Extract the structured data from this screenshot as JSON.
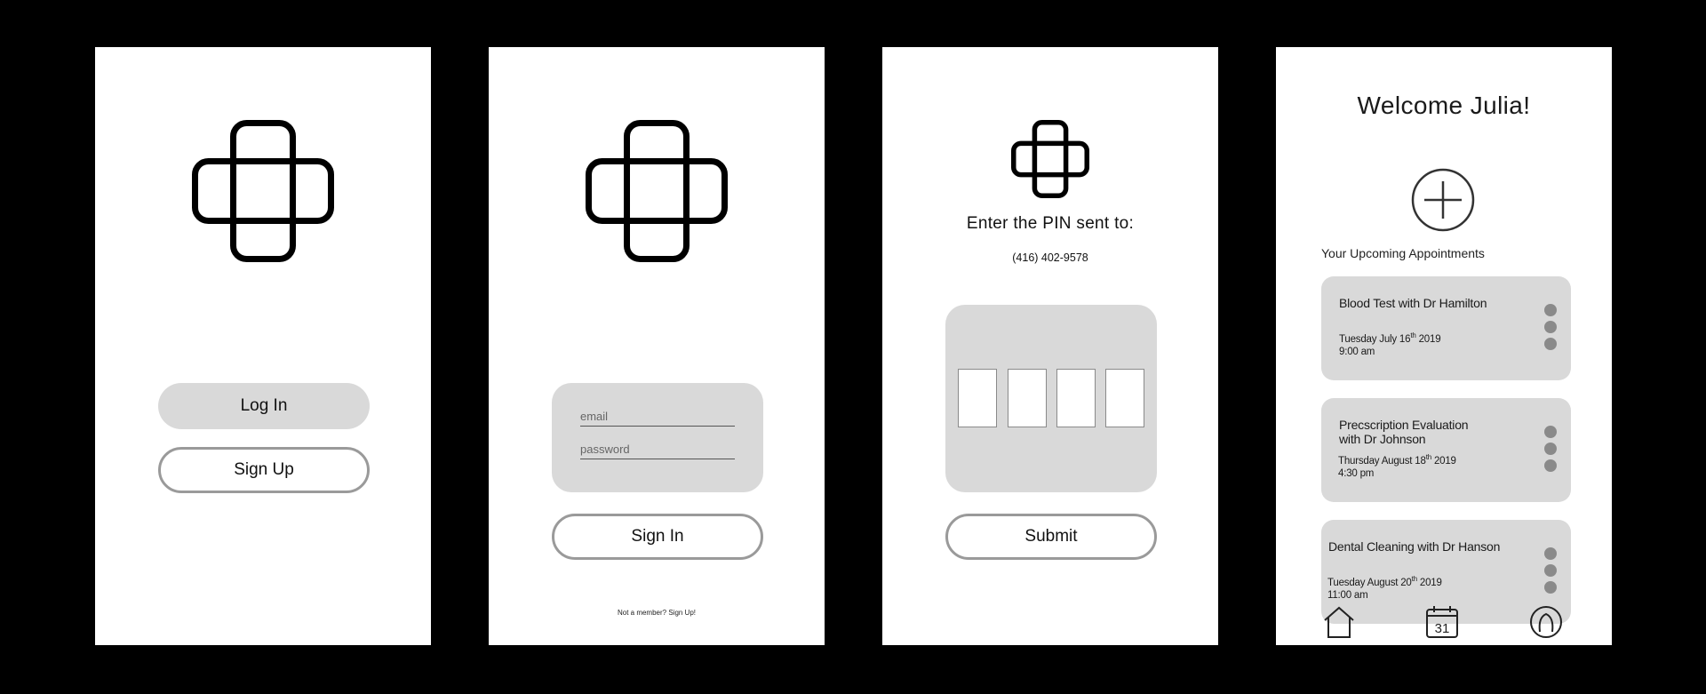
{
  "screen1": {
    "login_label": "Log In",
    "signup_label": "Sign Up"
  },
  "screen2": {
    "email_placeholder": "email",
    "password_placeholder": "password",
    "signin_label": "Sign In",
    "signup_link": "Not a member? Sign Up!"
  },
  "screen3": {
    "title": "Enter the PIN sent to:",
    "phone": "(416) 402-9578",
    "submit_label": "Submit"
  },
  "screen4": {
    "welcome": "Welcome Julia!",
    "section_label": "Your Upcoming Appointments",
    "appointments": [
      {
        "title_line1": "Blood Test with Dr Hamilton",
        "title_line2": "",
        "date_pre": "Tuesday July 16",
        "date_sup": "th",
        "date_post": " 2019",
        "time": "9:00 am"
      },
      {
        "title_line1": "Precscription Evaluation",
        "title_line2": "with Dr Johnson",
        "date_pre": "Thursday August 18",
        "date_sup": "th",
        "date_post": " 2019",
        "time": "4:30 pm"
      },
      {
        "title_line1": "Dental Cleaning with Dr Hanson",
        "title_line2": "",
        "date_pre": "Tuesday August 20",
        "date_sup": "th",
        "date_post": " 2019",
        "time": "11:00 am"
      }
    ],
    "calendar_day": "31",
    "tabs": [
      "home-icon",
      "calendar-icon",
      "profile-icon"
    ]
  },
  "colors": {
    "background": "#000000",
    "screen": "#ffffff",
    "panel": "#d9d9d9",
    "outline": "#9a9a9a",
    "dot": "#8a8a8a"
  }
}
